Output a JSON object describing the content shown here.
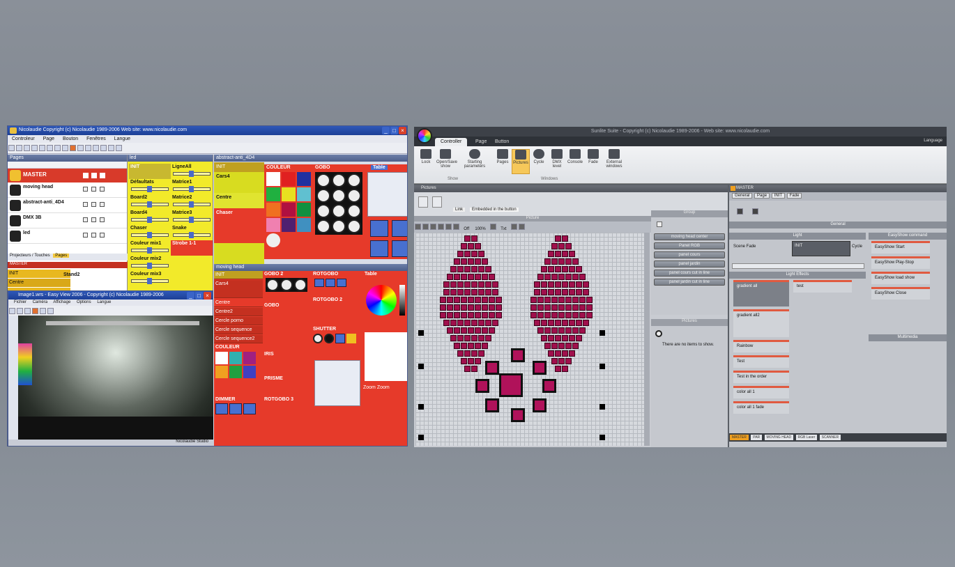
{
  "left_app": {
    "title": "Nicolaudie  Copyright (c) Nicolaudie 1989-2006  Web site: www.nicolaudie.com",
    "menu": [
      "Controleur",
      "Page",
      "Bouton",
      "Fenêtres",
      "Langue"
    ],
    "pages_panel": {
      "header": "Pages",
      "master": "MASTER",
      "items": [
        {
          "name": "moving head"
        },
        {
          "name": "abstract-anti_4D4"
        },
        {
          "name": "DMX 3B"
        },
        {
          "name": "led"
        }
      ],
      "tabs": "Projecteurs / Touches",
      "tab_selected": "Pages",
      "master_bar": "MASTER",
      "overlay_rows": [
        "INIT",
        "Centre"
      ],
      "overlay_label": "Stand2"
    },
    "yellow_panel": {
      "header": "led",
      "col1": [
        "INIT",
        "Défaultats",
        "Board2",
        "Board4",
        "Chaser",
        "Couleur mix1",
        "Couleur mix2",
        "Couleur mix3"
      ],
      "col2": [
        "LigneAll",
        "Matrice1",
        "Matrice2",
        "Matrice3",
        "Snake",
        "Strobe 1-1"
      ]
    },
    "panel_a": {
      "header": "abstract-anti_4D4",
      "items": [
        "INIT",
        "Cars4",
        "Centre",
        "Chaser"
      ],
      "sections": [
        "COULEUR",
        "GOBO",
        "Table"
      ]
    },
    "panel_b": {
      "header": "moving head",
      "items": [
        "INIT",
        "Cars4",
        "Centre",
        "Centre2",
        "Cercle porno",
        "Cercle sequence",
        "Cercle sequence2"
      ],
      "sections": [
        "GOBO 2",
        "GOBO",
        "COULEUR",
        "IRIS",
        "PRISME",
        "DIMMER",
        "ROTGOBO",
        "ROTGOBO 2",
        "ROTGOBO 3",
        "SHUTTER",
        "Table"
      ],
      "zoom_label": "Zoom Zoom"
    }
  },
  "easy_view": {
    "title": "Image1.wrs - Easy View 2006 - Copyright (c) Nicolaudie 1989-2006",
    "menu": [
      "Fichier",
      "Caméra",
      "Affichage",
      "Options",
      "Langue"
    ],
    "status": "Nicolaudie Studio"
  },
  "right_app": {
    "title": "Sunlite Suite - Copyright (c) Nicolaudie 1989-2006 - Web site: www.nicolaudie.com",
    "tabs": [
      "Controller",
      "Page",
      "Button"
    ],
    "active_tab": "Controller",
    "language": "Language",
    "ribbon": {
      "show": [
        {
          "label": "Lock"
        },
        {
          "label": "Open/Save show"
        },
        {
          "label": "Starting parameters"
        }
      ],
      "windows": [
        {
          "label": "Pages"
        },
        {
          "label": "Pictures"
        },
        {
          "label": "Cycle"
        },
        {
          "label": "DMX level"
        },
        {
          "label": "Console"
        },
        {
          "label": "Fade"
        },
        {
          "label": "External windows"
        }
      ],
      "group_labels": [
        "Show",
        "Windows"
      ]
    },
    "pictures": {
      "header": "Pictures",
      "tabs": [
        "Link",
        "Embedded in the button"
      ],
      "canvas_title": "Picture",
      "tool_labels": [
        "Off",
        "100%",
        "Txt"
      ]
    },
    "group": {
      "header": "Group",
      "buttons": [
        "moving head center",
        "Panel RGB",
        "panel cours",
        "panel jardin",
        "panel cours cut in line",
        "panel jardin cut in line"
      ],
      "pictures_header": "Pictures",
      "empty": "There are no items to show."
    },
    "master": {
      "header": "MASTER",
      "tabs": [
        "General",
        "Page",
        "INIT",
        "Fade"
      ],
      "general": "General",
      "light": "Light",
      "scene_fade": "Scene Fade",
      "init_label": "INIT",
      "cycle": "Cycle",
      "light_effects": "Light Effects",
      "effects": [
        "gradient all",
        "gradient all2",
        "Rainbow",
        "Test",
        "Test in the order",
        "color all 1",
        "color all 1 fade"
      ],
      "effect_right": "test",
      "easy_header": "EasyShow command",
      "easy": [
        "EasyShow Start",
        "EasyShow Play-Stop",
        "EasyShow load show",
        "EasyShow Close"
      ],
      "multimedia": "Multimedia",
      "status": [
        "MASTER",
        "PAR",
        "MOVING HEAD",
        "RGB Laser",
        "SCANNER"
      ]
    }
  }
}
